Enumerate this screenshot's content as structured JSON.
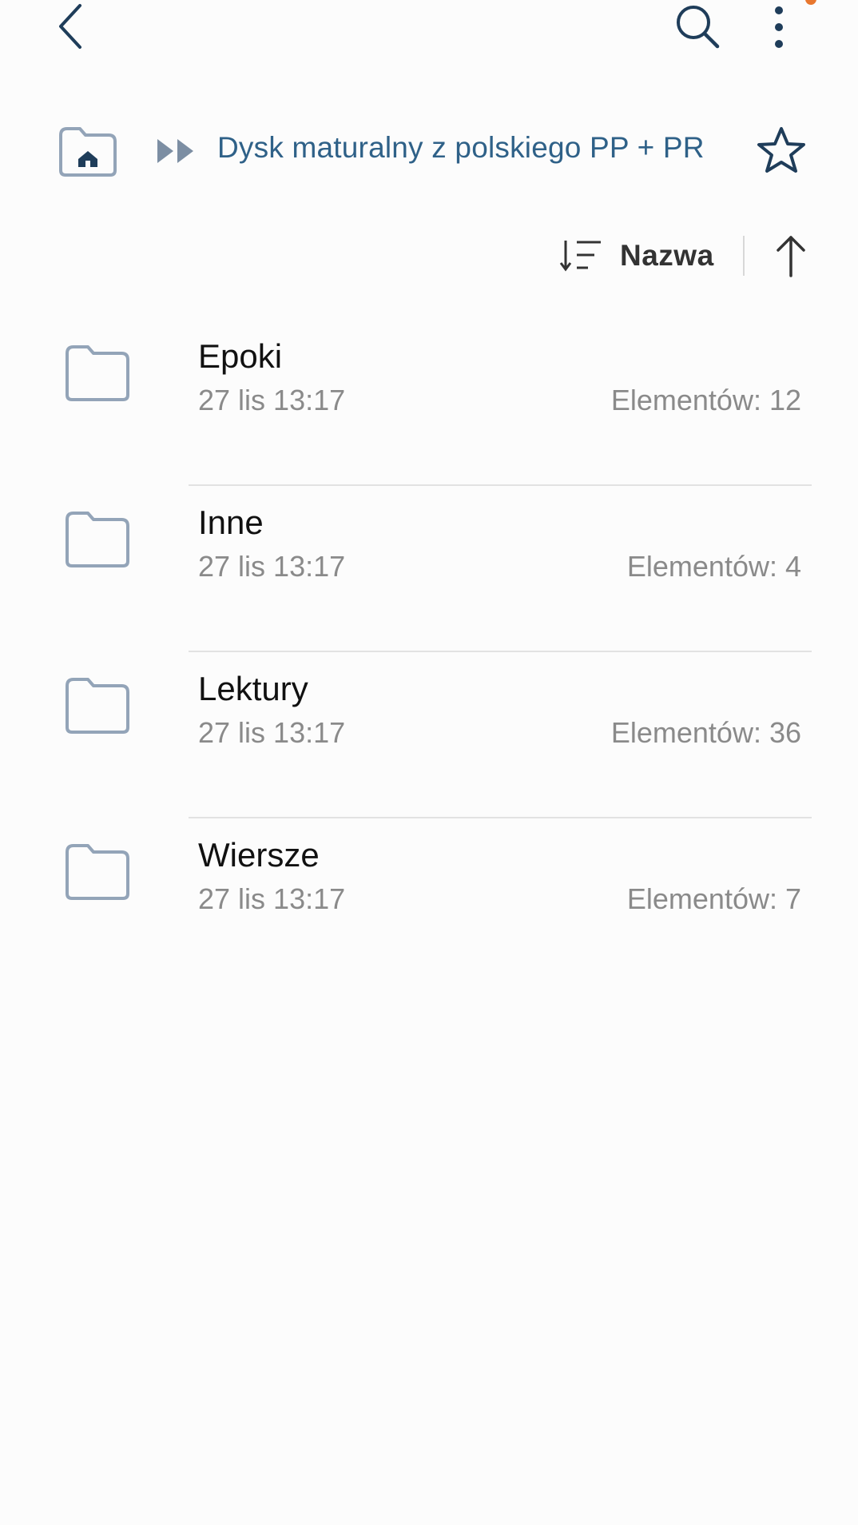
{
  "colors": {
    "accent_blue": "#2f6188",
    "accent_orange": "#e8772e",
    "icon_dark": "#1f3d5a",
    "folder_gray": "#93a4b8"
  },
  "topbar": {
    "back_icon": "back-chevron-icon",
    "search_icon": "search-icon",
    "more_icon": "more-vertical-icon"
  },
  "breadcrumb": {
    "home_icon": "home-folder-icon",
    "separator_icon": "double-arrow-icon",
    "current": "Dysk maturalny z polskiego PP + PR",
    "favorite_icon": "star-icon"
  },
  "sort": {
    "label": "Nazwa",
    "icon": "sort-icon",
    "direction_icon": "arrow-up-icon"
  },
  "folders": [
    {
      "name": "Epoki",
      "date": "27 lis 13:17",
      "count": "Elementów: 12"
    },
    {
      "name": "Inne",
      "date": "27 lis 13:17",
      "count": "Elementów: 4"
    },
    {
      "name": "Lektury",
      "date": "27 lis 13:17",
      "count": "Elementów: 36"
    },
    {
      "name": "Wiersze",
      "date": "27 lis 13:17",
      "count": "Elementów: 7"
    }
  ]
}
